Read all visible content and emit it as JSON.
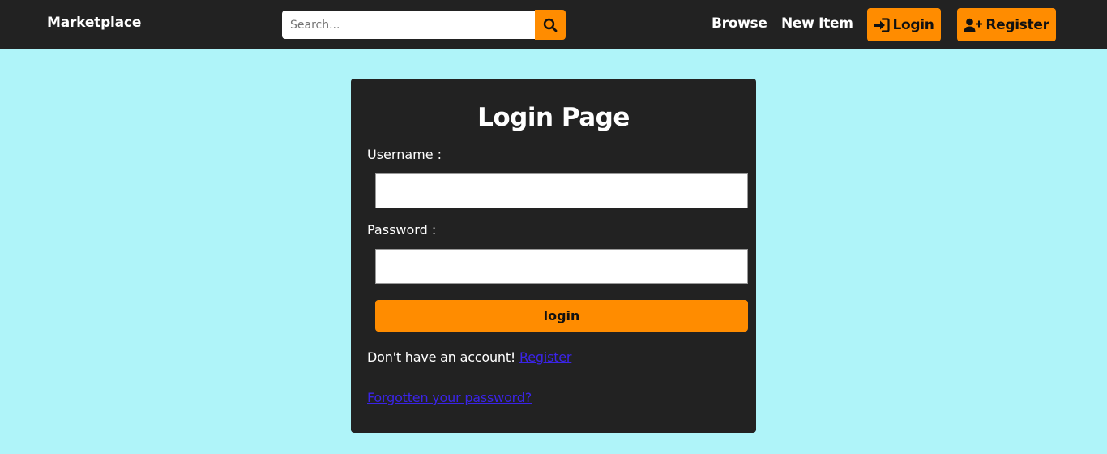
{
  "colors": {
    "page_background": "#aff4f9",
    "navbar_background": "#222222",
    "accent": "#ff8c00",
    "link": "#3b24e8",
    "card_background": "#222222"
  },
  "navbar": {
    "brand": "Marketplace",
    "search": {
      "placeholder": "Search...",
      "value": "",
      "icon": "search-icon"
    },
    "links": {
      "browse": "Browse",
      "new_item": "New Item"
    },
    "buttons": {
      "login": {
        "label": "Login",
        "icon": "sign-in-icon"
      },
      "register": {
        "label": "Register",
        "icon": "user-plus-icon"
      }
    }
  },
  "login_form": {
    "title": "Login Page",
    "username": {
      "label": "Username :",
      "value": ""
    },
    "password": {
      "label": "Password :",
      "value": ""
    },
    "submit_label": "login",
    "signup_prompt": "Don't have an account!",
    "signup_link": "Register",
    "forgot_link": "Forgotten your password?"
  }
}
